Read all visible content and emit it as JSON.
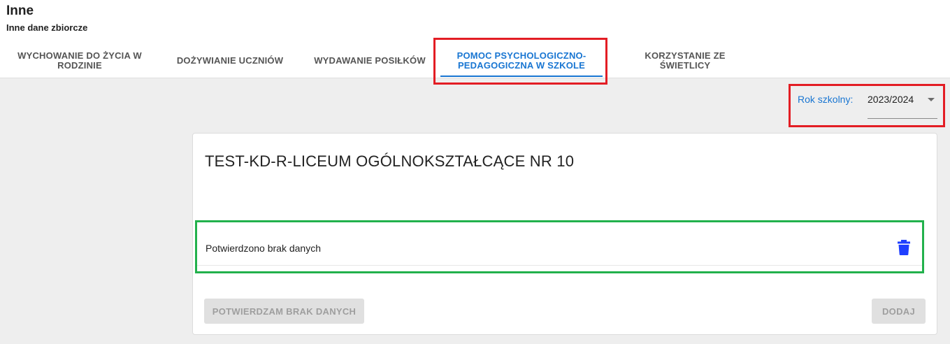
{
  "header": {
    "title": "Inne",
    "subtitle": "Inne dane zbiorcze"
  },
  "tabs": [
    {
      "label_line1": "WYCHOWANIE DO ŻYCIA W",
      "label_line2": "RODZINIE",
      "active": false
    },
    {
      "label_line1": "DOŻYWIANIE UCZNIÓW",
      "label_line2": "",
      "active": false
    },
    {
      "label_line1": "WYDAWANIE POSIŁKÓW",
      "label_line2": "",
      "active": false
    },
    {
      "label_line1": "POMOC PSYCHOLOGICZNO-",
      "label_line2": "PEDAGOGICZNA W SZKOLE",
      "active": true
    },
    {
      "label_line1": "KORZYSTANIE ZE",
      "label_line2": "ŚWIETLICY",
      "active": false
    }
  ],
  "school_year": {
    "label": "Rok szkolny:",
    "value": "2023/2024"
  },
  "card": {
    "school_name": "TEST-KD-R-LICEUM OGÓLNOKSZTAŁCĄCE NR 10",
    "entry_text": "Potwierdzono brak danych",
    "confirm_button": "POTWIERDZAM BRAK DANYCH",
    "add_button": "DODAJ"
  },
  "icons": {
    "delete": "trash-icon",
    "year_dropdown": "caret-down-icon"
  },
  "colors": {
    "accent": "#1976d2",
    "highlight_red": "#e31d24",
    "highlight_green": "#22b14c",
    "trash": "#1f3fff"
  }
}
